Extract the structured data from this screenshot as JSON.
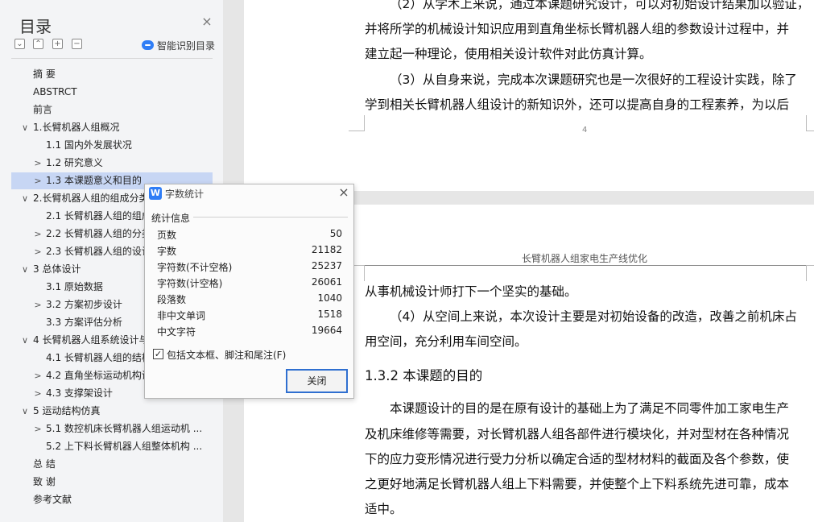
{
  "sidebar": {
    "title": "目录",
    "close_glyph": "×",
    "tools": [
      "⌄",
      "⌃",
      "+",
      "−"
    ],
    "ai_button": "智能识别目录",
    "items": [
      {
        "label": "摘  要",
        "level": 1,
        "chevron": ""
      },
      {
        "label": "ABSTRCT",
        "level": 1,
        "chevron": ""
      },
      {
        "label": "前言",
        "level": 1,
        "chevron": ""
      },
      {
        "label": "1.长臂机器人组概况",
        "level": 1,
        "chevron": "∨"
      },
      {
        "label": "1.1 国内外发展状况",
        "level": 2,
        "chevron": ""
      },
      {
        "label": "1.2 研究意义",
        "level": 2,
        "chevron": ">"
      },
      {
        "label": "1.3 本课题意义和目的",
        "level": 2,
        "chevron": ">"
      },
      {
        "label": "2.长臂机器人组的组成分类",
        "level": 1,
        "chevron": "∨"
      },
      {
        "label": "2.1 长臂机器人组的组成",
        "level": 2,
        "chevron": ""
      },
      {
        "label": "2.2 长臂机器人组的分类",
        "level": 2,
        "chevron": ">"
      },
      {
        "label": "2.3 长臂机器人组的设计",
        "level": 2,
        "chevron": ">"
      },
      {
        "label": "3 总体设计",
        "level": 1,
        "chevron": "∨"
      },
      {
        "label": "3.1 原始数据",
        "level": 2,
        "chevron": ""
      },
      {
        "label": "3.2 方案初步设计",
        "level": 2,
        "chevron": ">"
      },
      {
        "label": "3.3 方案评估分析",
        "level": 2,
        "chevron": ""
      },
      {
        "label": "4 长臂机器人组系统设计与",
        "level": 1,
        "chevron": "∨"
      },
      {
        "label": "4.1 长臂机器人组的结构",
        "level": 2,
        "chevron": ""
      },
      {
        "label": "4.2 直角坐标运动机构设",
        "level": 2,
        "chevron": ">"
      },
      {
        "label": "4.3 支撑架设计",
        "level": 2,
        "chevron": ">"
      },
      {
        "label": "5 运动结构仿真",
        "level": 1,
        "chevron": "∨"
      },
      {
        "label": "5.1 数控机床长臂机器人组运动机 ...",
        "level": 2,
        "chevron": ">"
      },
      {
        "label": "5.2 上下料长臂机器人组整体机构 ...",
        "level": 2,
        "chevron": ""
      },
      {
        "label": "总  结",
        "level": 1,
        "chevron": ""
      },
      {
        "label": "致  谢",
        "level": 1,
        "chevron": ""
      },
      {
        "label": "参考文献",
        "level": 1,
        "chevron": ""
      }
    ],
    "selected_index": 6
  },
  "document": {
    "page1_lines": [
      "（2）从学术上来说，通过本课题研究设计，可以对初始设计结果加以验证，",
      "并将所学的机械设计知识应用到直角坐标长臂机器人组的参数设计过程中，并",
      "建立起一种理论，使用相关设计软件对此仿真计算。",
      "（3）从自身来说，完成本次课题研究也是一次很好的工程设计实践，除了",
      "学到相关长臂机器人组设计的新知识外，还可以提高自身的工程素养，为以后"
    ],
    "page_number": "4",
    "page2_header": "长臂机器人组家电生产线优化",
    "page2_lines_a": [
      "从事机械设计师打下一个坚实的基础。",
      "（4）从空间上来说，本次设计主要是对初始设备的改造，改善之前机床占",
      "用空间，充分利用车间空间。"
    ],
    "heading": "1.3.2 本课题的目的",
    "page2_lines_b": [
      "本课题设计的目的是在原有设计的基础上为了满足不同零件加工家电生产",
      "及机床维修等需要，对长臂机器人组各部件进行模块化，并对型材在各种情况",
      "下的应力变形情况进行受力分析以确定合适的型材材料的截面及各个参数，使",
      "之更好地满足长臂机器人组上下料需要，并使整个上下料系统先进可靠，成本",
      "适中。"
    ]
  },
  "dialog": {
    "icon_letter": "W",
    "title": "字数统计",
    "close_glyph": "×",
    "group_label": "统计信息",
    "stats": [
      {
        "label": "页数",
        "value": "50"
      },
      {
        "label": "字数",
        "value": "21182"
      },
      {
        "label": "字符数(不计空格)",
        "value": "25237"
      },
      {
        "label": "字符数(计空格)",
        "value": "26061"
      },
      {
        "label": "段落数",
        "value": "1040"
      },
      {
        "label": "非中文单词",
        "value": "1518"
      },
      {
        "label": "中文字符",
        "value": "19664"
      }
    ],
    "checkbox_label": "包括文本框、脚注和尾注(F)",
    "checkbox_checked": true,
    "close_button": "关闭"
  }
}
